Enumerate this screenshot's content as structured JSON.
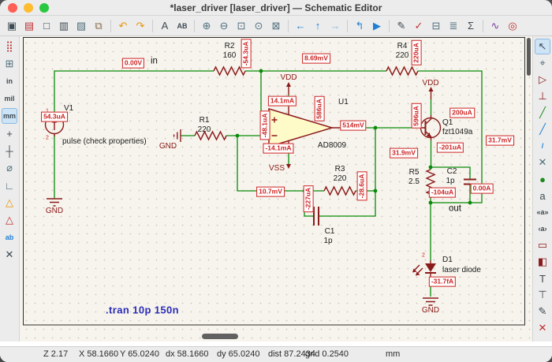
{
  "window": {
    "title": "*laser_driver [laser_driver] — Schematic Editor"
  },
  "colors": {
    "wire": "#0a8a0a",
    "symbol": "#8b1a1a",
    "annotation": "#cd2323",
    "canvas_bg": "#f6f4ec",
    "opamp_fill": "#fffbc9",
    "directive_blue": "#2d2db8",
    "chrome_bg": "#ececec",
    "traffic_red": "#ff5f57",
    "traffic_yellow": "#febc2e",
    "traffic_green": "#28c840",
    "active_tool_bg": "#cde3f6"
  },
  "toolbar_top": {
    "items": [
      {
        "name": "save",
        "glyph": "▣"
      },
      {
        "name": "schematic-setup",
        "glyph": "▤"
      },
      {
        "name": "page-settings",
        "glyph": "□"
      },
      {
        "name": "print",
        "glyph": "▥"
      },
      {
        "name": "plot",
        "glyph": "▨"
      },
      {
        "name": "paste",
        "glyph": "⧉"
      },
      {
        "name": "undo",
        "glyph": "↶"
      },
      {
        "name": "redo",
        "glyph": "↷"
      },
      {
        "name": "find",
        "glyph": "A"
      },
      {
        "name": "find-replace",
        "glyph": "AB"
      },
      {
        "name": "zoom-in",
        "glyph": "⊕"
      },
      {
        "name": "zoom-out",
        "glyph": "⊖"
      },
      {
        "name": "zoom-fit",
        "glyph": "⊡"
      },
      {
        "name": "zoom-objects",
        "glyph": "⊙"
      },
      {
        "name": "zoom-selection",
        "glyph": "⊠"
      },
      {
        "name": "nav-back",
        "glyph": "←"
      },
      {
        "name": "nav-up",
        "glyph": "↑"
      },
      {
        "name": "nav-forward",
        "glyph": "→"
      },
      {
        "name": "leave-sheet",
        "glyph": "↰"
      },
      {
        "name": "hierarchy-navigator",
        "glyph": "▶"
      },
      {
        "name": "annotate",
        "glyph": "✎"
      },
      {
        "name": "erc",
        "glyph": "✓"
      },
      {
        "name": "assign-footprints",
        "glyph": "⊟"
      },
      {
        "name": "symbol-fields",
        "glyph": "≣"
      },
      {
        "name": "bom",
        "glyph": "Σ"
      },
      {
        "name": "simulator",
        "glyph": "∿"
      },
      {
        "name": "highlight-net",
        "glyph": "◎"
      }
    ]
  },
  "toolbar_left": {
    "items": [
      {
        "name": "grid-toggle",
        "glyph": "⣿"
      },
      {
        "name": "grid-overrides",
        "glyph": "⊞"
      },
      {
        "name": "units-inches",
        "glyph": "in"
      },
      {
        "name": "units-mils",
        "glyph": "mil"
      },
      {
        "name": "units-mm",
        "glyph": "mm"
      },
      {
        "name": "cursor-shape",
        "glyph": "+"
      },
      {
        "name": "crosshair-fullscreen",
        "glyph": "┼"
      },
      {
        "name": "hidden-pins",
        "glyph": "⌀"
      },
      {
        "name": "hv-lines",
        "glyph": "∟"
      },
      {
        "name": "erc-warnings",
        "glyph": "△"
      },
      {
        "name": "erc-errors",
        "glyph": "△"
      },
      {
        "name": "fields-visibility",
        "glyph": "ab"
      },
      {
        "name": "erc-exclusions",
        "glyph": "✕"
      }
    ]
  },
  "toolbar_right": {
    "items": [
      {
        "name": "select-tool",
        "glyph": "↖"
      },
      {
        "name": "highlight-net-tool",
        "glyph": "⌖"
      },
      {
        "name": "add-symbol",
        "glyph": "▷"
      },
      {
        "name": "add-power",
        "glyph": "⊥"
      },
      {
        "name": "add-wire",
        "glyph": "╱"
      },
      {
        "name": "add-bus",
        "glyph": "╱"
      },
      {
        "name": "bus-entry",
        "glyph": "/"
      },
      {
        "name": "no-connect",
        "glyph": "✕"
      },
      {
        "name": "junction",
        "glyph": "●"
      },
      {
        "name": "net-label",
        "glyph": "a"
      },
      {
        "name": "global-label",
        "glyph": "«a»"
      },
      {
        "name": "hier-label",
        "glyph": "‹a›"
      },
      {
        "name": "add-sheet",
        "glyph": "▭"
      },
      {
        "name": "sheet-pin",
        "glyph": "◧"
      },
      {
        "name": "add-text",
        "glyph": "T"
      },
      {
        "name": "text-box",
        "glyph": "⊤"
      },
      {
        "name": "draw-shapes",
        "glyph": "✎"
      },
      {
        "name": "delete-tool",
        "glyph": "✕"
      }
    ]
  },
  "schematic": {
    "directive": ".tran 10p 150n",
    "labels": {
      "in": "in",
      "out": "out"
    },
    "power": {
      "vdd": "VDD",
      "vss": "VSS",
      "gnd": "GND"
    },
    "components": {
      "v1": {
        "ref": "V1",
        "value": "pulse (check properties)"
      },
      "r1": {
        "ref": "R1",
        "value": "220"
      },
      "r2": {
        "ref": "R2",
        "value": "160"
      },
      "r3": {
        "ref": "R3",
        "value": "220"
      },
      "r4": {
        "ref": "R4",
        "value": "220"
      },
      "r5": {
        "ref": "R5",
        "value": "2.5"
      },
      "c1": {
        "ref": "C1",
        "value": "1p"
      },
      "c2": {
        "ref": "C2",
        "value": "1p"
      },
      "u1": {
        "ref": "U1",
        "value": "AD8009"
      },
      "q1": {
        "ref": "Q1",
        "value": "fzt1049a"
      },
      "d1": {
        "ref": "D1",
        "value": "laser diode"
      }
    },
    "pins": {
      "v1_1": "1",
      "v1_2": "2",
      "d1_2": "2"
    },
    "annotations": {
      "net_in_voltage": "0.00V",
      "r2_current": "-54.3uA",
      "mid_node_voltage": "8.69mV",
      "r4_current": "220uA",
      "v1_current": "54.3uA",
      "u1_vplus_current": "14.1mA",
      "u1_supply_current": "586uA",
      "u1_input_current": "-48.1uA",
      "u1_output_voltage": "514mV",
      "u1_vminus_current": "-14.1mA",
      "feedback_node_voltage": "10.7mV",
      "r3_current": "-28.6uA",
      "c1_current": "-227uA",
      "q1_collector_current": "596uA",
      "q1_base_current": "200uA",
      "q1_emitter_current": "-201uA",
      "emitter_node_voltage": "31.9mV",
      "out_net_voltage": "31.7mV",
      "r5_current": "-104uA",
      "c2_current": "0.00A",
      "d1_current": "-31.7fA"
    }
  },
  "status": {
    "zoom": "Z 2.17",
    "x": "X 58.1660",
    "y": "Y 65.0240",
    "dx": "dx 58.1660",
    "dy": "dy 65.0240",
    "dist": "dist 87.2434",
    "grid": "grid 0.2540",
    "units": "mm"
  }
}
